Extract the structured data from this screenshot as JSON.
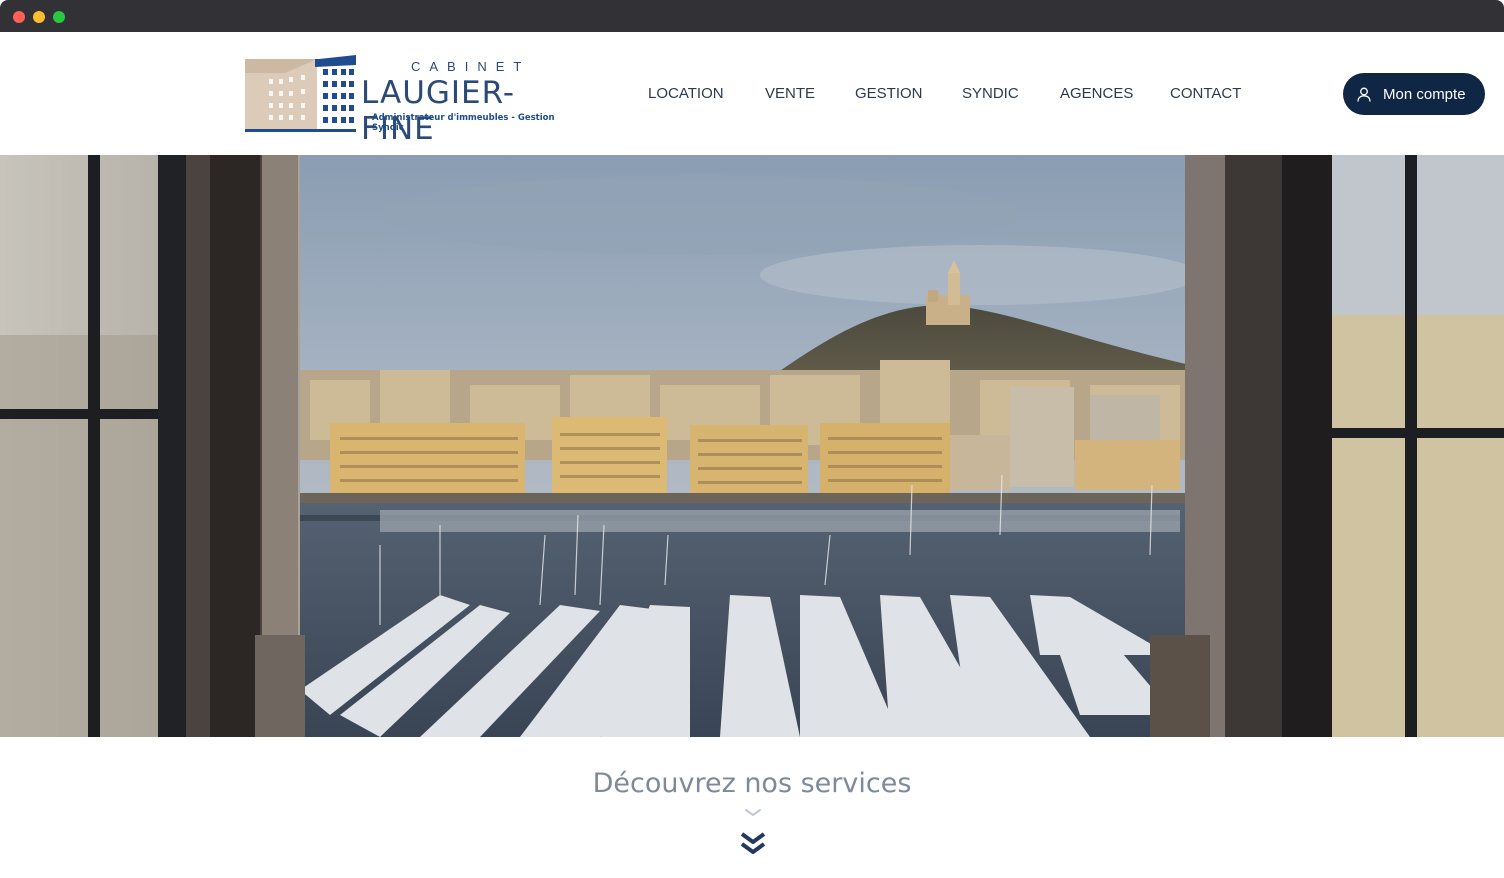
{
  "window": {
    "controls": [
      "close",
      "minimize",
      "maximize"
    ]
  },
  "header": {
    "logo": {
      "line1": "CABINET",
      "line2": "LAUGIER-FINE",
      "tagline": "Administrateur d'immeubles - Gestion Syndic",
      "icon": "building-logo-icon"
    },
    "nav": [
      "LOCATION",
      "VENTE",
      "GESTION",
      "SYNDIC",
      "AGENCES",
      "CONTACT"
    ],
    "account_button": {
      "label": "Mon compte",
      "icon": "user-icon"
    }
  },
  "hero": {
    "image": "Vieux-Port de Marseille vu d'une fenêtre, Notre-Dame de la Garde"
  },
  "services": {
    "title": "Découvrez nos services",
    "icons": [
      "chevron-down-icon",
      "double-chevron-down-icon"
    ]
  },
  "colors": {
    "brand_navy": "#0f2744",
    "logo_blue": "#2c4a78",
    "logo_beige": "#d8c7b4",
    "title_gray": "#7e8a9c",
    "nav_text": "#2b3a4e",
    "chrome": "#323236"
  }
}
